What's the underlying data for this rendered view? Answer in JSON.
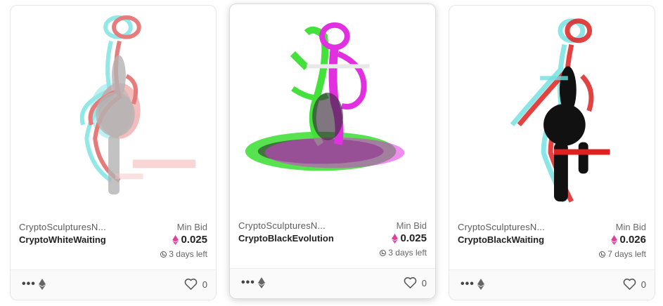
{
  "cards": [
    {
      "collection": "CryptoSculpturesN...",
      "name": "CryptoWhiteWaiting",
      "min_bid_label": "Min Bid",
      "price": "0.025",
      "time_left": "3 days left",
      "likes": "0"
    },
    {
      "collection": "CryptoSculpturesN...",
      "name": "CryptoBlackEvolution",
      "min_bid_label": "Min Bid",
      "price": "0.025",
      "time_left": "3 days left",
      "likes": "0"
    },
    {
      "collection": "CryptoSculpturesN...",
      "name": "CryptoBlackWaiting",
      "min_bid_label": "Min Bid",
      "price": "0.026",
      "time_left": "7 days left",
      "likes": "0"
    }
  ],
  "icons": {
    "more": "more-dots-icon",
    "chain": "ethereum-icon",
    "like": "heart-icon",
    "timer": "clock-icon"
  },
  "colors": {
    "price_eth": "#e0409a",
    "glitch_cyan": "#6ee0e0",
    "glitch_red": "#e05050",
    "glitch_green": "#44e03c",
    "glitch_magenta": "#e030e0"
  }
}
